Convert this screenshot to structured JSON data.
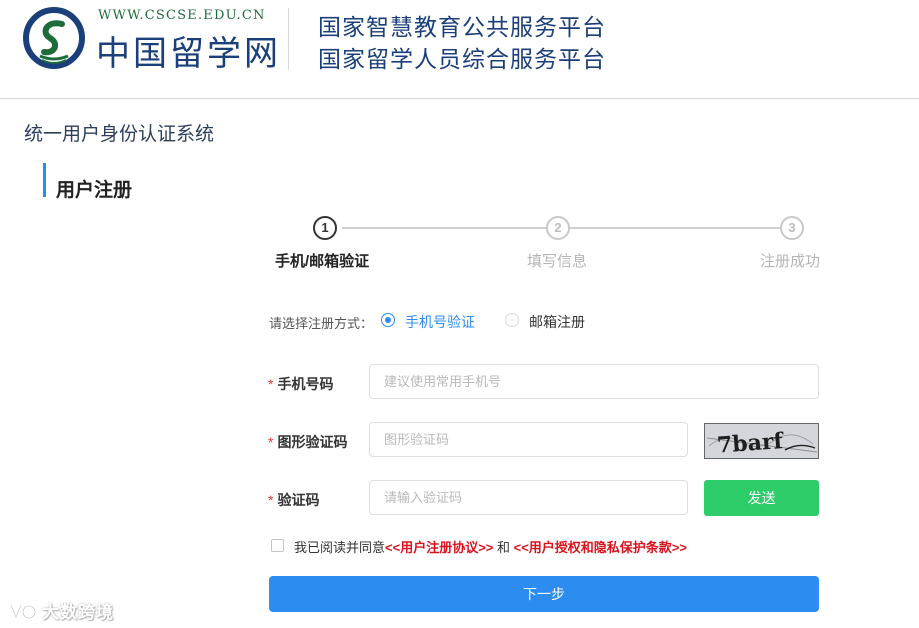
{
  "header": {
    "logo_url_text": "WWW.CSCSE.EDU.CN",
    "logo_cn_text": "中国留学网",
    "platform_line1": "国家智慧教育公共服务平台",
    "platform_line2": "国家留学人员综合服务平台"
  },
  "system_title": "统一用户身份认证系统",
  "section_title": "用户注册",
  "steps": [
    {
      "number": "1",
      "label": "手机/邮箱验证",
      "active": true
    },
    {
      "number": "2",
      "label": "填写信息",
      "active": false
    },
    {
      "number": "3",
      "label": "注册成功",
      "active": false
    }
  ],
  "registration_method": {
    "label": "请选择注册方式：",
    "options": [
      {
        "label": "手机号验证",
        "selected": true
      },
      {
        "label": "邮箱注册",
        "selected": false
      }
    ]
  },
  "form": {
    "phone": {
      "label": "手机号码",
      "value": "",
      "placeholder": "建议使用常用手机号"
    },
    "captcha": {
      "label": "图形验证码",
      "value": "",
      "placeholder": "图形验证码",
      "image_text": "7barf"
    },
    "code": {
      "label": "验证码",
      "value": "",
      "placeholder": "请输入验证码"
    },
    "send_label": "发送",
    "required_mark": "*"
  },
  "agreement": {
    "checked": false,
    "prefix": "我已阅读并同意",
    "link1": "<<用户注册协议>>",
    "conjunction": " 和 ",
    "link2": "<<用户授权和隐私保护条款>>"
  },
  "next_label": "下一步",
  "watermark": {
    "text": "大数跨境"
  },
  "colors": {
    "primary": "#2d8cf0",
    "success": "#2fcc6a",
    "link_red": "#d9141c",
    "brand_navy": "#1b3f7a",
    "brand_green": "#1d6c3a"
  }
}
